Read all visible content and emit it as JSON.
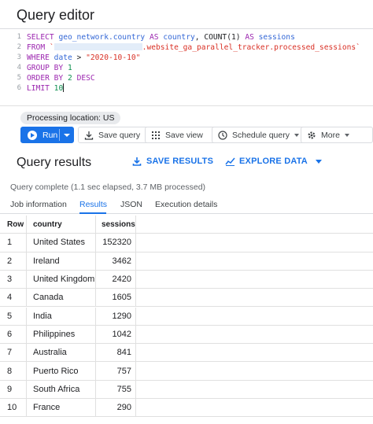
{
  "window": {
    "title": "Query editor"
  },
  "editor": {
    "line_numbers": [
      "1",
      "2",
      "3",
      "4",
      "5",
      "6"
    ],
    "lines": [
      [
        {
          "t": "kw",
          "v": "SELECT"
        },
        {
          "t": "txt",
          "v": " "
        },
        {
          "t": "id",
          "v": "geo_network.country"
        },
        {
          "t": "txt",
          "v": " "
        },
        {
          "t": "kw",
          "v": "AS"
        },
        {
          "t": "txt",
          "v": " "
        },
        {
          "t": "id",
          "v": "country"
        },
        {
          "t": "txt",
          "v": ", "
        },
        {
          "t": "txt",
          "v": "COUNT(1)"
        },
        {
          "t": "txt",
          "v": " "
        },
        {
          "t": "kw",
          "v": "AS"
        },
        {
          "t": "txt",
          "v": " "
        },
        {
          "t": "id",
          "v": "sessions"
        }
      ],
      [
        {
          "t": "kw",
          "v": "FROM"
        },
        {
          "t": "txt",
          "v": " "
        },
        {
          "t": "str",
          "v": "`"
        },
        {
          "t": "redact",
          "v": ""
        },
        {
          "t": "str",
          "v": ".website_ga_parallel_tracker.processed_sessions`"
        }
      ],
      [
        {
          "t": "kw",
          "v": "WHERE"
        },
        {
          "t": "txt",
          "v": " "
        },
        {
          "t": "id",
          "v": "date"
        },
        {
          "t": "txt",
          "v": " > "
        },
        {
          "t": "str",
          "v": "\"2020-10-10\""
        }
      ],
      [
        {
          "t": "kw",
          "v": "GROUP BY"
        },
        {
          "t": "txt",
          "v": " "
        },
        {
          "t": "num",
          "v": "1"
        }
      ],
      [
        {
          "t": "kw",
          "v": "ORDER BY"
        },
        {
          "t": "txt",
          "v": " "
        },
        {
          "t": "num",
          "v": "2"
        },
        {
          "t": "txt",
          "v": " "
        },
        {
          "t": "kw",
          "v": "DESC"
        }
      ],
      [
        {
          "t": "kw",
          "v": "LIMIT"
        },
        {
          "t": "txt",
          "v": " "
        },
        {
          "t": "num",
          "v": "10"
        },
        {
          "t": "cursor",
          "v": ""
        }
      ]
    ]
  },
  "processing_location": "Processing location: US",
  "toolbar": {
    "run_label": "Run",
    "save_query_label": "Save query",
    "save_view_label": "Save view",
    "schedule_query_label": "Schedule query",
    "more_label": "More"
  },
  "results": {
    "title": "Query results",
    "save_results_label": "SAVE RESULTS",
    "explore_data_label": "EXPLORE DATA",
    "status": "Query complete (1.1 sec elapsed, 3.7 MB processed)"
  },
  "tabs": [
    {
      "label": "Job information",
      "active": false
    },
    {
      "label": "Results",
      "active": true
    },
    {
      "label": "JSON",
      "active": false
    },
    {
      "label": "Execution details",
      "active": false
    }
  ],
  "table": {
    "columns": [
      "Row",
      "country",
      "sessions"
    ],
    "rows": [
      [
        "1",
        "United States",
        "152320"
      ],
      [
        "2",
        "Ireland",
        "3462"
      ],
      [
        "3",
        "United Kingdom",
        "2420"
      ],
      [
        "4",
        "Canada",
        "1605"
      ],
      [
        "5",
        "India",
        "1290"
      ],
      [
        "6",
        "Philippines",
        "1042"
      ],
      [
        "7",
        "Australia",
        "841"
      ],
      [
        "8",
        "Puerto Rico",
        "757"
      ],
      [
        "9",
        "South Africa",
        "755"
      ],
      [
        "10",
        "France",
        "290"
      ]
    ]
  },
  "colors": {
    "accent": "#1a73e8",
    "keyword": "#9c27b0",
    "string": "#d93025",
    "number": "#0d904f"
  }
}
